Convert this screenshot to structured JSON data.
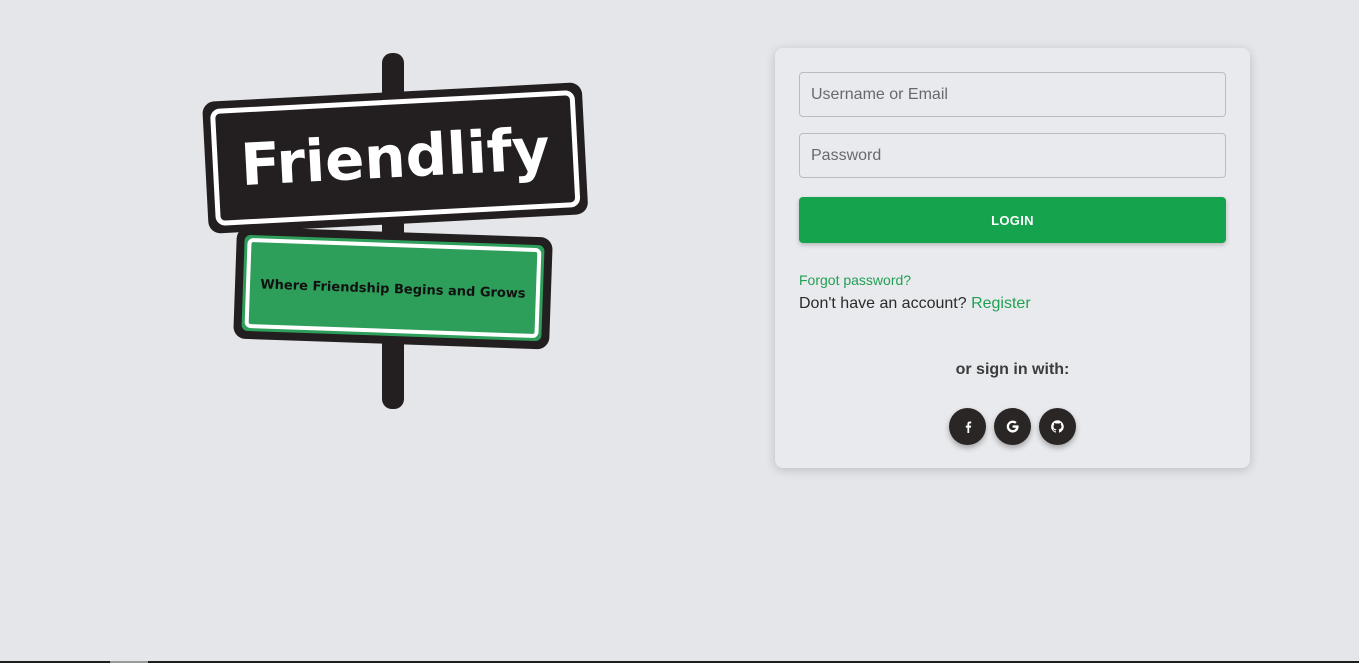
{
  "brand": {
    "name": "Friendlify",
    "tagline": "Where Friendship Begins and Grows"
  },
  "login_form": {
    "username_placeholder": "Username or Email",
    "password_placeholder": "Password",
    "login_label": "LOGIN",
    "forgot_password": "Forgot password?",
    "no_account_text": "Don't have an account?",
    "register_label": "Register",
    "or_sign_in_with": "or sign in with:"
  },
  "social_login": [
    {
      "icon": "facebook-icon"
    },
    {
      "icon": "google-icon"
    },
    {
      "icon": "github-icon"
    }
  ],
  "colors": {
    "background": "#e4e6ea",
    "accent_green": "#15a34e",
    "link_green": "#22a055",
    "sign_black": "#231f20",
    "sign_green": "#2e9e5b"
  }
}
